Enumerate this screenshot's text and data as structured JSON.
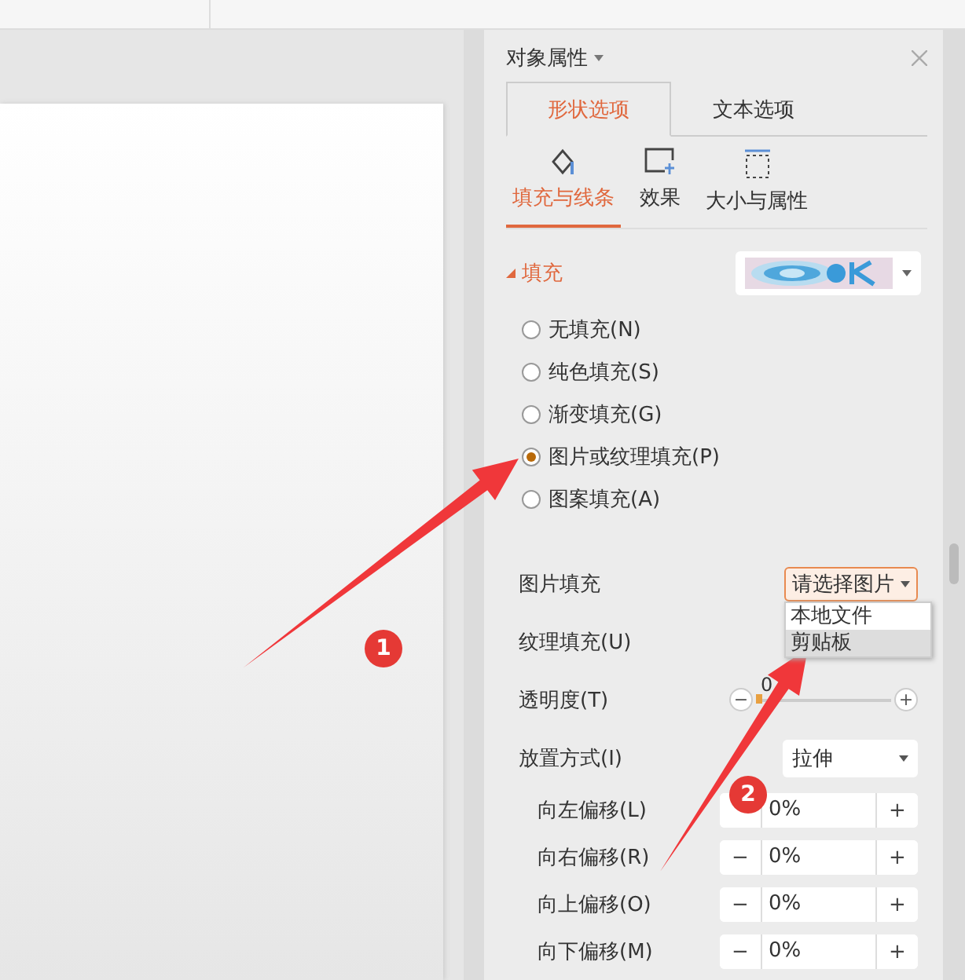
{
  "panel": {
    "title": "对象属性"
  },
  "tabs": [
    {
      "label": "形状选项",
      "selected": true
    },
    {
      "label": "文本选项",
      "selected": false
    }
  ],
  "subtabs": [
    {
      "label": "填充与线条",
      "kind": "fill",
      "selected": true
    },
    {
      "label": "效果",
      "kind": "effect",
      "selected": false
    },
    {
      "label": "大小与属性",
      "kind": "size",
      "selected": false
    }
  ],
  "fill": {
    "heading": "填充",
    "expanded": true,
    "options": [
      {
        "label": "无填充(N)",
        "selected": false
      },
      {
        "label": "纯色填充(S)",
        "selected": false
      },
      {
        "label": "渐变填充(G)",
        "selected": false
      },
      {
        "label": "图片或纹理填充(P)",
        "selected": true
      },
      {
        "label": "图案填充(A)",
        "selected": false
      }
    ]
  },
  "picture_fill": {
    "label": "图片填充",
    "button": "请选择图片",
    "open": true,
    "menu": [
      {
        "label": "本地文件",
        "selected": false
      },
      {
        "label": "剪贴板",
        "selected": true
      }
    ]
  },
  "texture_fill": {
    "label": "纹理填充(U)"
  },
  "transparency": {
    "label": "透明度(T)",
    "reading": "0",
    "level": 0
  },
  "placement": {
    "label": "放置方式(I)",
    "value": "拉伸"
  },
  "stepper": {
    "minus": "−",
    "plus": "+"
  },
  "offsets": [
    {
      "label": "向左偏移(L)",
      "value": "0%",
      "minus_covered": true
    },
    {
      "label": "向右偏移(R)",
      "value": "0%",
      "minus_covered": false
    },
    {
      "label": "向上偏移(O)",
      "value": "0%",
      "minus_covered": false
    },
    {
      "label": "向下偏移(M)",
      "value": "0%",
      "minus_covered": false
    }
  ],
  "annotations": [
    {
      "number": "1"
    },
    {
      "number": "2"
    }
  ]
}
